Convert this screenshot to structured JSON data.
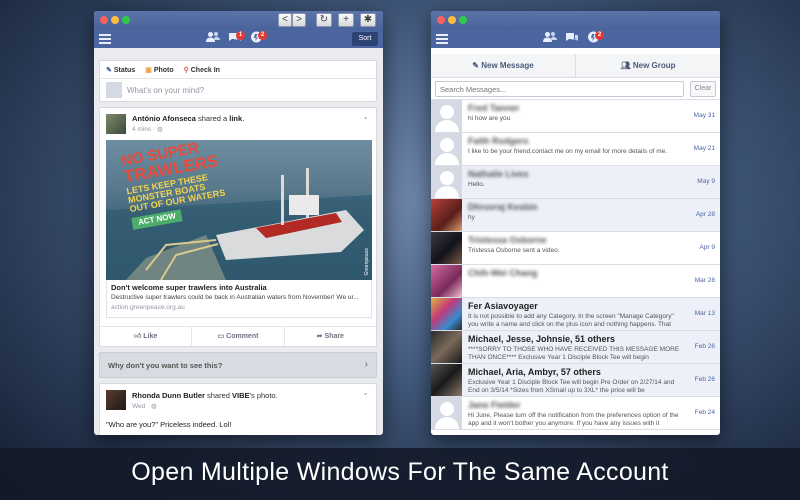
{
  "left_window": {
    "toolbar": {
      "back": "<",
      "forward": ">",
      "refresh": "↻",
      "new": "+",
      "settings": "✱"
    },
    "nav": {
      "friends_badge": "1",
      "notifications_badge": "2",
      "sort_label": "Sort"
    },
    "composer": {
      "status_label": "Status",
      "photo_label": "Photo",
      "checkin_label": "Check In",
      "placeholder": "What's on your mind?"
    },
    "post1": {
      "author": "António Afonseca",
      "action": "shared a",
      "object": "link",
      "time": "4 mins",
      "image_lines": [
        "NO SUPER",
        "TRAWLERS",
        "LETS KEEP THESE",
        "MONSTER BOATS",
        "OUT OF OUR WATERS",
        "ACT NOW"
      ],
      "image_source": "Greenpeace",
      "link_title": "Don't welcome super trawlers into Australia",
      "link_desc": "Destructive super trawlers could be back in Australian waters from November! We ur...",
      "link_domain": "action.greenpeace.org.au",
      "like_label": "Like",
      "comment_label": "Comment",
      "share_label": "Share"
    },
    "feedback_bar": "Why don't you want to see this?",
    "post2": {
      "author": "Rhonda Dunn Butler",
      "action": "shared",
      "object": "VIBE",
      "suffix": "'s photo.",
      "time": "Wed",
      "text": "\"Who are you?\" Priceless indeed. Lol!"
    }
  },
  "right_window": {
    "nav": {
      "notifications_badge": "2"
    },
    "new_message_label": "New Message",
    "new_group_label": "New Group",
    "search_placeholder": "Search Messages...",
    "clear_label": "Clear",
    "messages": [
      {
        "name": "Fred Tanner",
        "preview": "hi how are you",
        "date": "May 31",
        "unread": false,
        "blur": true,
        "avatar": "placeholder"
      },
      {
        "name": "Faith Rodgers",
        "preview": "I like to be your friend,contact me on my email for more details of me.",
        "date": "May 21",
        "unread": false,
        "blur": true,
        "avatar": "placeholder"
      },
      {
        "name": "Nathalie Lives",
        "preview": "Hello.",
        "date": "May 9",
        "unread": true,
        "blur": true,
        "avatar": "placeholder"
      },
      {
        "name": "Dhruvraj Kesbin",
        "preview": "hy",
        "date": "Apr 28",
        "unread": true,
        "blur": true,
        "avatar": "photo-red"
      },
      {
        "name": "Tristessa Osborne",
        "preview": "Tristessa Osborne sent a video.",
        "date": "Apr 9",
        "unread": false,
        "blur": true,
        "avatar": "photo-dark"
      },
      {
        "name": "Chih-Wei Chang",
        "preview": "",
        "date": "Mar 28",
        "unread": false,
        "blur": true,
        "avatar": "photo-pink"
      },
      {
        "name": "Fer Asiavoyager",
        "preview": "It is not possible to add any Category. In the screen \"Manage Category\" you write a name and click on the plus icon and nothing happens. That",
        "date": "Mar 13",
        "unread": true,
        "blur": false,
        "avatar": "photo-colorful"
      },
      {
        "name": "Michael, Jesse, Johnsie, 51 others",
        "preview": "****SORRY TO THOSE WHO HAVE RECEIVED THIS MESSAGE MORE THAN ONCE**** Exclusive Year 1 Disciple Block Tee will begin",
        "date": "Feb 26",
        "unread": true,
        "blur": false,
        "avatar": "photo-group"
      },
      {
        "name": "Michael, Aria, Ambyr, 57 others",
        "preview": "Exclusive Year 1 Disciple Block Tee will begin Pre Order on 2/27/14 and End on 3/5/14 *Sizes from XSmall up to 3XL* the price will be",
        "date": "Feb 26",
        "unread": true,
        "blur": false,
        "avatar": "photo-group2"
      },
      {
        "name": "Jane Fielder",
        "preview": "Hi June, Please turn off the notification from the preferences option of the app and it won't bother you anymore. If you have any issues with it",
        "date": "Feb 24",
        "unread": false,
        "blur": true,
        "avatar": "placeholder"
      }
    ]
  },
  "caption": "Open Multiple Windows For The Same Account"
}
